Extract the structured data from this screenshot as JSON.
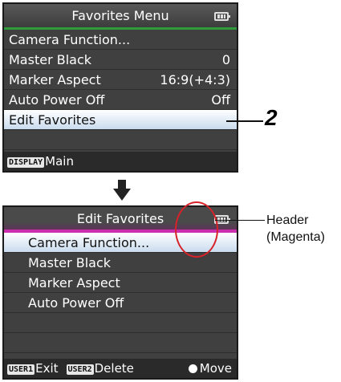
{
  "top_screen": {
    "title": "Favorites Menu",
    "items": [
      {
        "label": "Camera Function...",
        "value": ""
      },
      {
        "label": "Master Black",
        "value": "0"
      },
      {
        "label": "Marker Aspect",
        "value": "16:9(+4:3)"
      },
      {
        "label": "Auto Power Off",
        "value": "Off"
      },
      {
        "label": "Edit Favorites",
        "value": ""
      }
    ],
    "footer": {
      "tag": "DISPLAY",
      "label": "Main"
    }
  },
  "bottom_screen": {
    "title": "Edit Favorites",
    "items": [
      {
        "label": "Camera Function..."
      },
      {
        "label": "Master Black"
      },
      {
        "label": "Marker Aspect"
      },
      {
        "label": "Auto Power Off"
      }
    ],
    "footer": {
      "user1_tag": "USER1",
      "user1_label": "Exit",
      "user2_tag": "USER2",
      "user2_label": "Delete",
      "move_label": "Move"
    }
  },
  "annotations": {
    "step_number": "2",
    "header_note_line1": "Header",
    "header_note_line2": "(Magenta)"
  },
  "colors": {
    "top_header_bar": "#2f9a3a",
    "bottom_header_bar": "#cc2fae",
    "highlight_circle": "#d8222a"
  }
}
